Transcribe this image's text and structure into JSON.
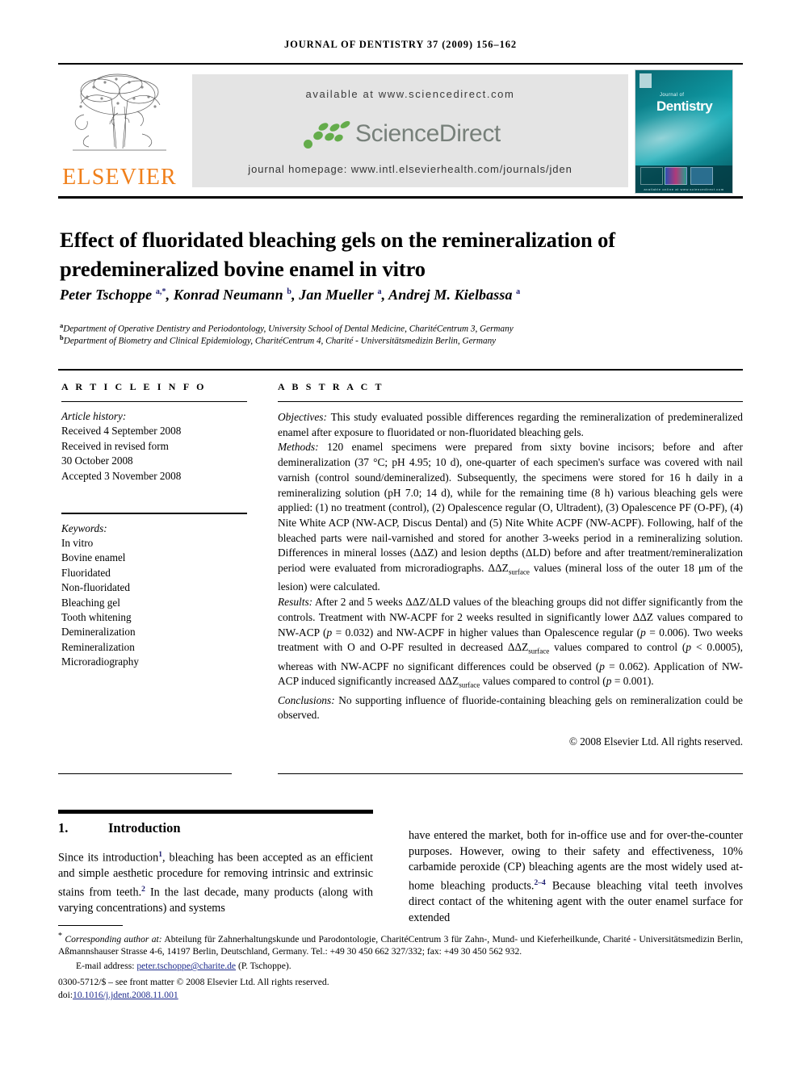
{
  "running_head": "JOURNAL OF DENTISTRY 37 (2009) 156–162",
  "masthead": {
    "publisher_name": "ELSEVIER",
    "available_at": "available at www.sciencedirect.com",
    "sciencedirect_wordmark": "ScienceDirect",
    "journal_homepage": "journal homepage: www.intl.elsevierhealth.com/journals/jden",
    "cover": {
      "kicker": "Journal of",
      "title": "Dentistry",
      "footer": "available online at www.sciencedirect.com"
    }
  },
  "article": {
    "title": "Effect of fluoridated bleaching gels on the remineralization of predemineralized bovine enamel in vitro",
    "authors_html": "Peter Tschoppe <sup>a,*</sup>, Konrad Neumann <sup>b</sup>, Jan Mueller <sup>a</sup>, Andrej M. Kielbassa <sup>a</sup>",
    "affiliation_a": "Department of Operative Dentistry and Periodontology, University School of Dental Medicine, CharitéCentrum 3, Germany",
    "affiliation_b": "Department of Biometry and Clinical Epidemiology, CharitéCentrum 4, Charité - Universitätsmedizin Berlin, Germany"
  },
  "info": {
    "heading": "A R T I C L E   I N F O",
    "history_label": "Article history:",
    "history": [
      "Received 4 September 2008",
      "Received in revised form",
      "30 October 2008",
      "Accepted 3 November 2008"
    ],
    "keywords_label": "Keywords:",
    "keywords": [
      "In vitro",
      "Bovine enamel",
      "Fluoridated",
      "Non-fluoridated",
      "Bleaching gel",
      "Tooth whitening",
      "Demineralization",
      "Remineralization",
      "Microradiography"
    ]
  },
  "abstract": {
    "heading": "A B S T R A C T",
    "objectives_label": "Objectives:",
    "objectives": " This study evaluated possible differences regarding the remineralization of predemineralized enamel after exposure to fluoridated or non-fluoridated bleaching gels.",
    "methods_label": "Methods:",
    "methods": " 120 enamel specimens were prepared from sixty bovine incisors; before and after demineralization (37 °C; pH 4.95; 10 d), one-quarter of each specimen's surface was covered with nail varnish (control sound/demineralized). Subsequently, the specimens were stored for 16 h daily in a remineralizing solution (pH 7.0; 14 d), while for the remaining time (8 h) various bleaching gels were applied: (1) no treatment (control), (2) Opalescence regular (O, Ultradent), (3) Opalescence PF (O-PF), (4) Nite White ACP (NW-ACP, Discus Dental) and (5) Nite White ACPF (NW-ACPF). Following, half of the bleached parts were nail-varnished and stored for another 3-weeks period in a remineralizing solution. Differences in mineral losses (ΔΔZ) and lesion depths (ΔLD) before and after treatment/remineralization period were evaluated from microradiographs. ΔΔZsurface values (mineral loss of the outer 18 μm of the lesion) were calculated.",
    "results_label": "Results:",
    "results": " After 2 and 5 weeks ΔΔZ/ΔLD values of the bleaching groups did not differ significantly from the controls. Treatment with NW-ACPF for 2 weeks resulted in significantly lower ΔΔZ values compared to NW-ACP (p = 0.032) and NW-ACPF in higher values than Opalescence regular (p = 0.006). Two weeks treatment with O and O-PF resulted in decreased ΔΔZsurface values compared to control (p < 0.0005), whereas with NW-ACPF no significant differences could be observed (p = 0.062). Application of NW-ACP induced significantly increased ΔΔZsurface values compared to control (p = 0.001).",
    "conclusions_label": "Conclusions:",
    "conclusions": " No supporting influence of fluoride-containing bleaching gels on remineralization could be observed.",
    "copyright": "© 2008 Elsevier Ltd. All rights reserved."
  },
  "introduction": {
    "number": "1.",
    "heading": "Introduction",
    "left_column": "Since its introduction<sup>1</sup>, bleaching has been accepted as an efficient and simple aesthetic procedure for removing intrinsic and extrinsic stains from teeth.<sup>2</sup> In the last decade, many products (along with varying concentrations) and systems",
    "right_column": "have entered the market, both for in-office use and for over-the-counter purposes. However, owing to their safety and effectiveness, 10% carbamide peroxide (CP) bleaching agents are the most widely used at-home bleaching products.<sup>2–4</sup> Because bleaching vital teeth involves direct contact of the whitening agent with the outer enamel surface for extended"
  },
  "footnotes": {
    "corresponding_label": "Corresponding author at:",
    "corresponding": " Abteilung für Zahnerhaltungskunde und Parodontologie, CharitéCentrum 3 für Zahn-, Mund- und Kieferheilkunde, Charité - Universitätsmedizin Berlin, Aßmannshauser Strasse 4-6, 14197 Berlin, Deutschland, Germany. Tel.: +49 30 450 662 327/332; fax: +49 30 450 562 932.",
    "email_label": "E-mail address:",
    "email": "peter.tschoppe@charite.de",
    "email_owner": "(P. Tschoppe).",
    "issn_line": "0300-5712/$ – see front matter © 2008 Elsevier Ltd. All rights reserved.",
    "doi_label": "doi:",
    "doi_value": "10.1016/j.jdent.2008.11.001"
  },
  "colors": {
    "elsevier_orange": "#F07F1A",
    "link_blue": "#1d2a8c",
    "sciencedirect_green": "#64ac4b",
    "sciencedirect_gray": "#77807a",
    "banner_gray": "#e4e4e4"
  }
}
